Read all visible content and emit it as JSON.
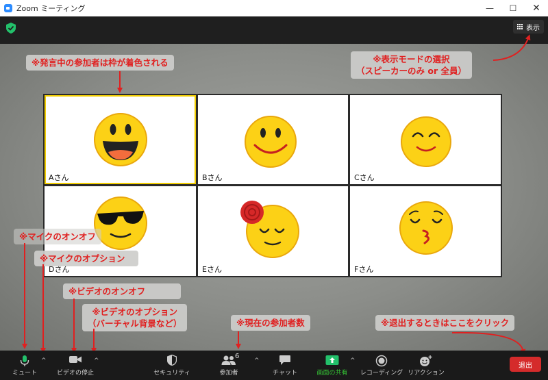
{
  "window": {
    "title": "Zoom ミーティング",
    "controls": [
      "—",
      "☐",
      "✕"
    ]
  },
  "topbar": {
    "view_button": "表示"
  },
  "participants": [
    {
      "name": "Aさん",
      "face": "grin",
      "active": true
    },
    {
      "name": "Bさん",
      "face": "smile",
      "active": false
    },
    {
      "name": "Cさん",
      "face": "happy-eyes",
      "active": false
    },
    {
      "name": "Dさん",
      "face": "sunglasses",
      "active": false
    },
    {
      "name": "Eさん",
      "face": "relieved",
      "active": false
    },
    {
      "name": "Fさん",
      "face": "kissing",
      "active": false
    }
  ],
  "annotations": {
    "active_speaker": "※発言中の参加者は枠が着色される",
    "view_mode_line1": "※表示モードの選択",
    "view_mode_line2": "（スピーカーのみ or 全員）",
    "mic_onoff": "※マイクのオンオフ",
    "mic_options": "※マイクのオプション",
    "video_onoff": "※ビデオのオンオフ",
    "video_options_line1": "※ビデオのオプション",
    "video_options_line2": "（バーチャル背景など）",
    "participant_count": "※現在の参加者数",
    "leave": "※退出するときはここをクリック"
  },
  "toolbar": {
    "mute": "ミュート",
    "stop_video": "ビデオの停止",
    "security": "セキュリティ",
    "participants": "参加者",
    "participant_count": "6",
    "chat": "チャット",
    "share_screen": "画面の共有",
    "recording": "レコーディング",
    "reactions": "リアクション",
    "leave": "退出"
  },
  "colors": {
    "annotation_red": "#e02020",
    "active_border": "#f2cd00",
    "share_green": "#35c435",
    "leave_red": "#d52b2b"
  }
}
